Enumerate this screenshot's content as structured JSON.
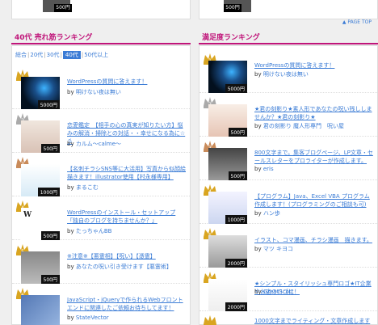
{
  "page_top": "▲ PAGE TOP",
  "top_prices": {
    "left": "500円",
    "right": "500円"
  },
  "left": {
    "heading": "40代 売れ筋ランキング",
    "tabs": [
      "総合",
      "20代",
      "30代",
      "40代",
      "50代以上"
    ],
    "active_tab": "40代",
    "items": [
      {
        "title": "WordPressの質問に答えます！",
        "author": "明けない夜は無い",
        "price": "5000円",
        "rank": 1
      },
      {
        "title": "恋愛鑑定　【相手の心の真実が知りたい方】悩みの解消・掃除との対話・・幸せになる為に☆彡",
        "author": "カルム～calme～",
        "price": "500円",
        "rank": 2
      },
      {
        "title": "【名刺チラシSNS等に大活用】写真から似顔絵描きます！illustrator使用【村永様専用】",
        "author": "まるこむ",
        "price": "1000円",
        "rank": 3
      },
      {
        "title": "WordPressのインストール・セットアップ 「独自のブログを持ちませんか？」",
        "author": "たっちゃんBB",
        "price": "500円",
        "rank": 4
      },
      {
        "title": "※注意※【悪霊相】【呪い】【憑霊】",
        "author": "あなたの呪い引き受けます【悪霊術】",
        "price": "500円",
        "rank": 5
      },
      {
        "title": "JavaScript・jQueryで作られるWebフロントエンドに関連したご依頼お待ちしてます！",
        "author": "StateVector",
        "price": "",
        "rank": 6
      }
    ]
  },
  "right": {
    "heading": "満足度ランキング",
    "items": [
      {
        "title": "WordPressの質問に答えます！",
        "author": "明けない夜は無い",
        "price": "5000円",
        "rank": 1
      },
      {
        "title": "★君の刻影り★素人形であなたの呪い残ししませんか？★君の刻影り★",
        "author": "君の刻影り 魔人形専門　呪い屋",
        "price": "500円",
        "rank": 2
      },
      {
        "title": "800文字まで。集客ブログページ、LP文章・セールスレターをプロライターが作成します。",
        "author": "eris",
        "price": "500円",
        "rank": 3
      },
      {
        "title": "【プログラム】Java、Excel VBA プログラム作成します！(プログラミングのご相談も可)",
        "author": "ハン歩",
        "price": "1000円",
        "rank": 4
      },
      {
        "title": "イラスト、コマ漫画、チラシ漫画　描きます。",
        "author": "マツ キヨコ",
        "price": "2000円",
        "rank": 5
      },
      {
        "title": "★シンプル・スタイリッシュ専門ロゴ★IT企業やお店のロゴに！",
        "author": "GreatScott",
        "price": "2000円",
        "rank": 6
      },
      {
        "title": "1000文字までライティング・文章作成します",
        "author": "",
        "price": "",
        "rank": 7
      }
    ]
  },
  "by_label": "by",
  "colors": {
    "accent": "#c0157a",
    "link": "#3a7bd5",
    "gold": "#d9a520",
    "silver": "#aaaaaa",
    "bronze": "#c98b5a"
  }
}
